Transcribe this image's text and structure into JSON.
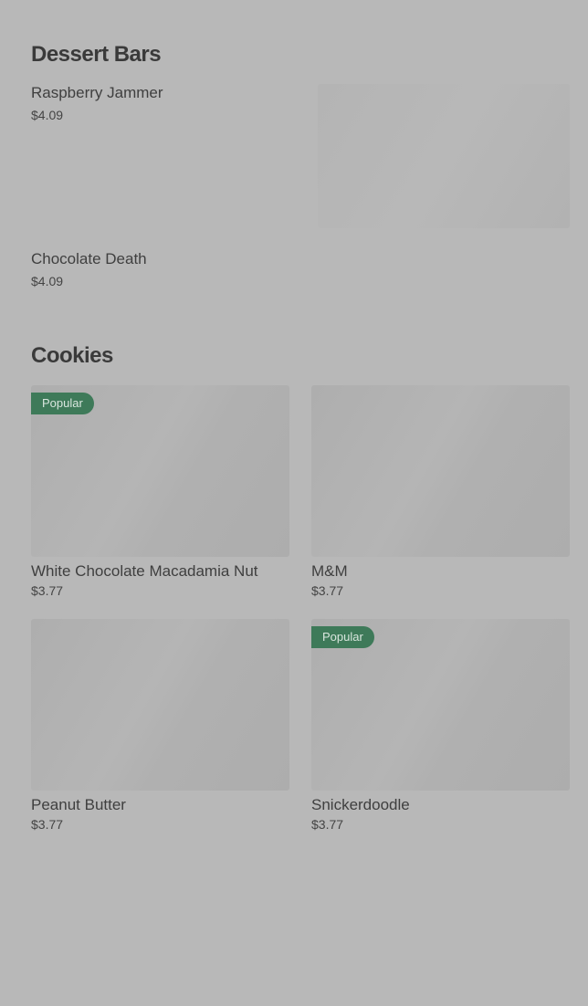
{
  "sections": [
    {
      "title": "Dessert Bars",
      "items": [
        {
          "name": "Raspberry Jammer",
          "price": "$4.09"
        },
        {
          "name": "Chocolate Death",
          "price": "$4.09"
        }
      ]
    },
    {
      "title": "Cookies",
      "items": [
        {
          "name": "White Chocolate Macadamia Nut",
          "price": "$3.77",
          "badge": "Popular"
        },
        {
          "name": "M&M",
          "price": "$3.77"
        },
        {
          "name": "Peanut Butter",
          "price": "$3.77"
        },
        {
          "name": "Snickerdoodle",
          "price": "$3.77",
          "badge": "Popular"
        }
      ]
    }
  ],
  "colors": {
    "background": "#b8b8b8",
    "badge": "#3e7a59"
  }
}
